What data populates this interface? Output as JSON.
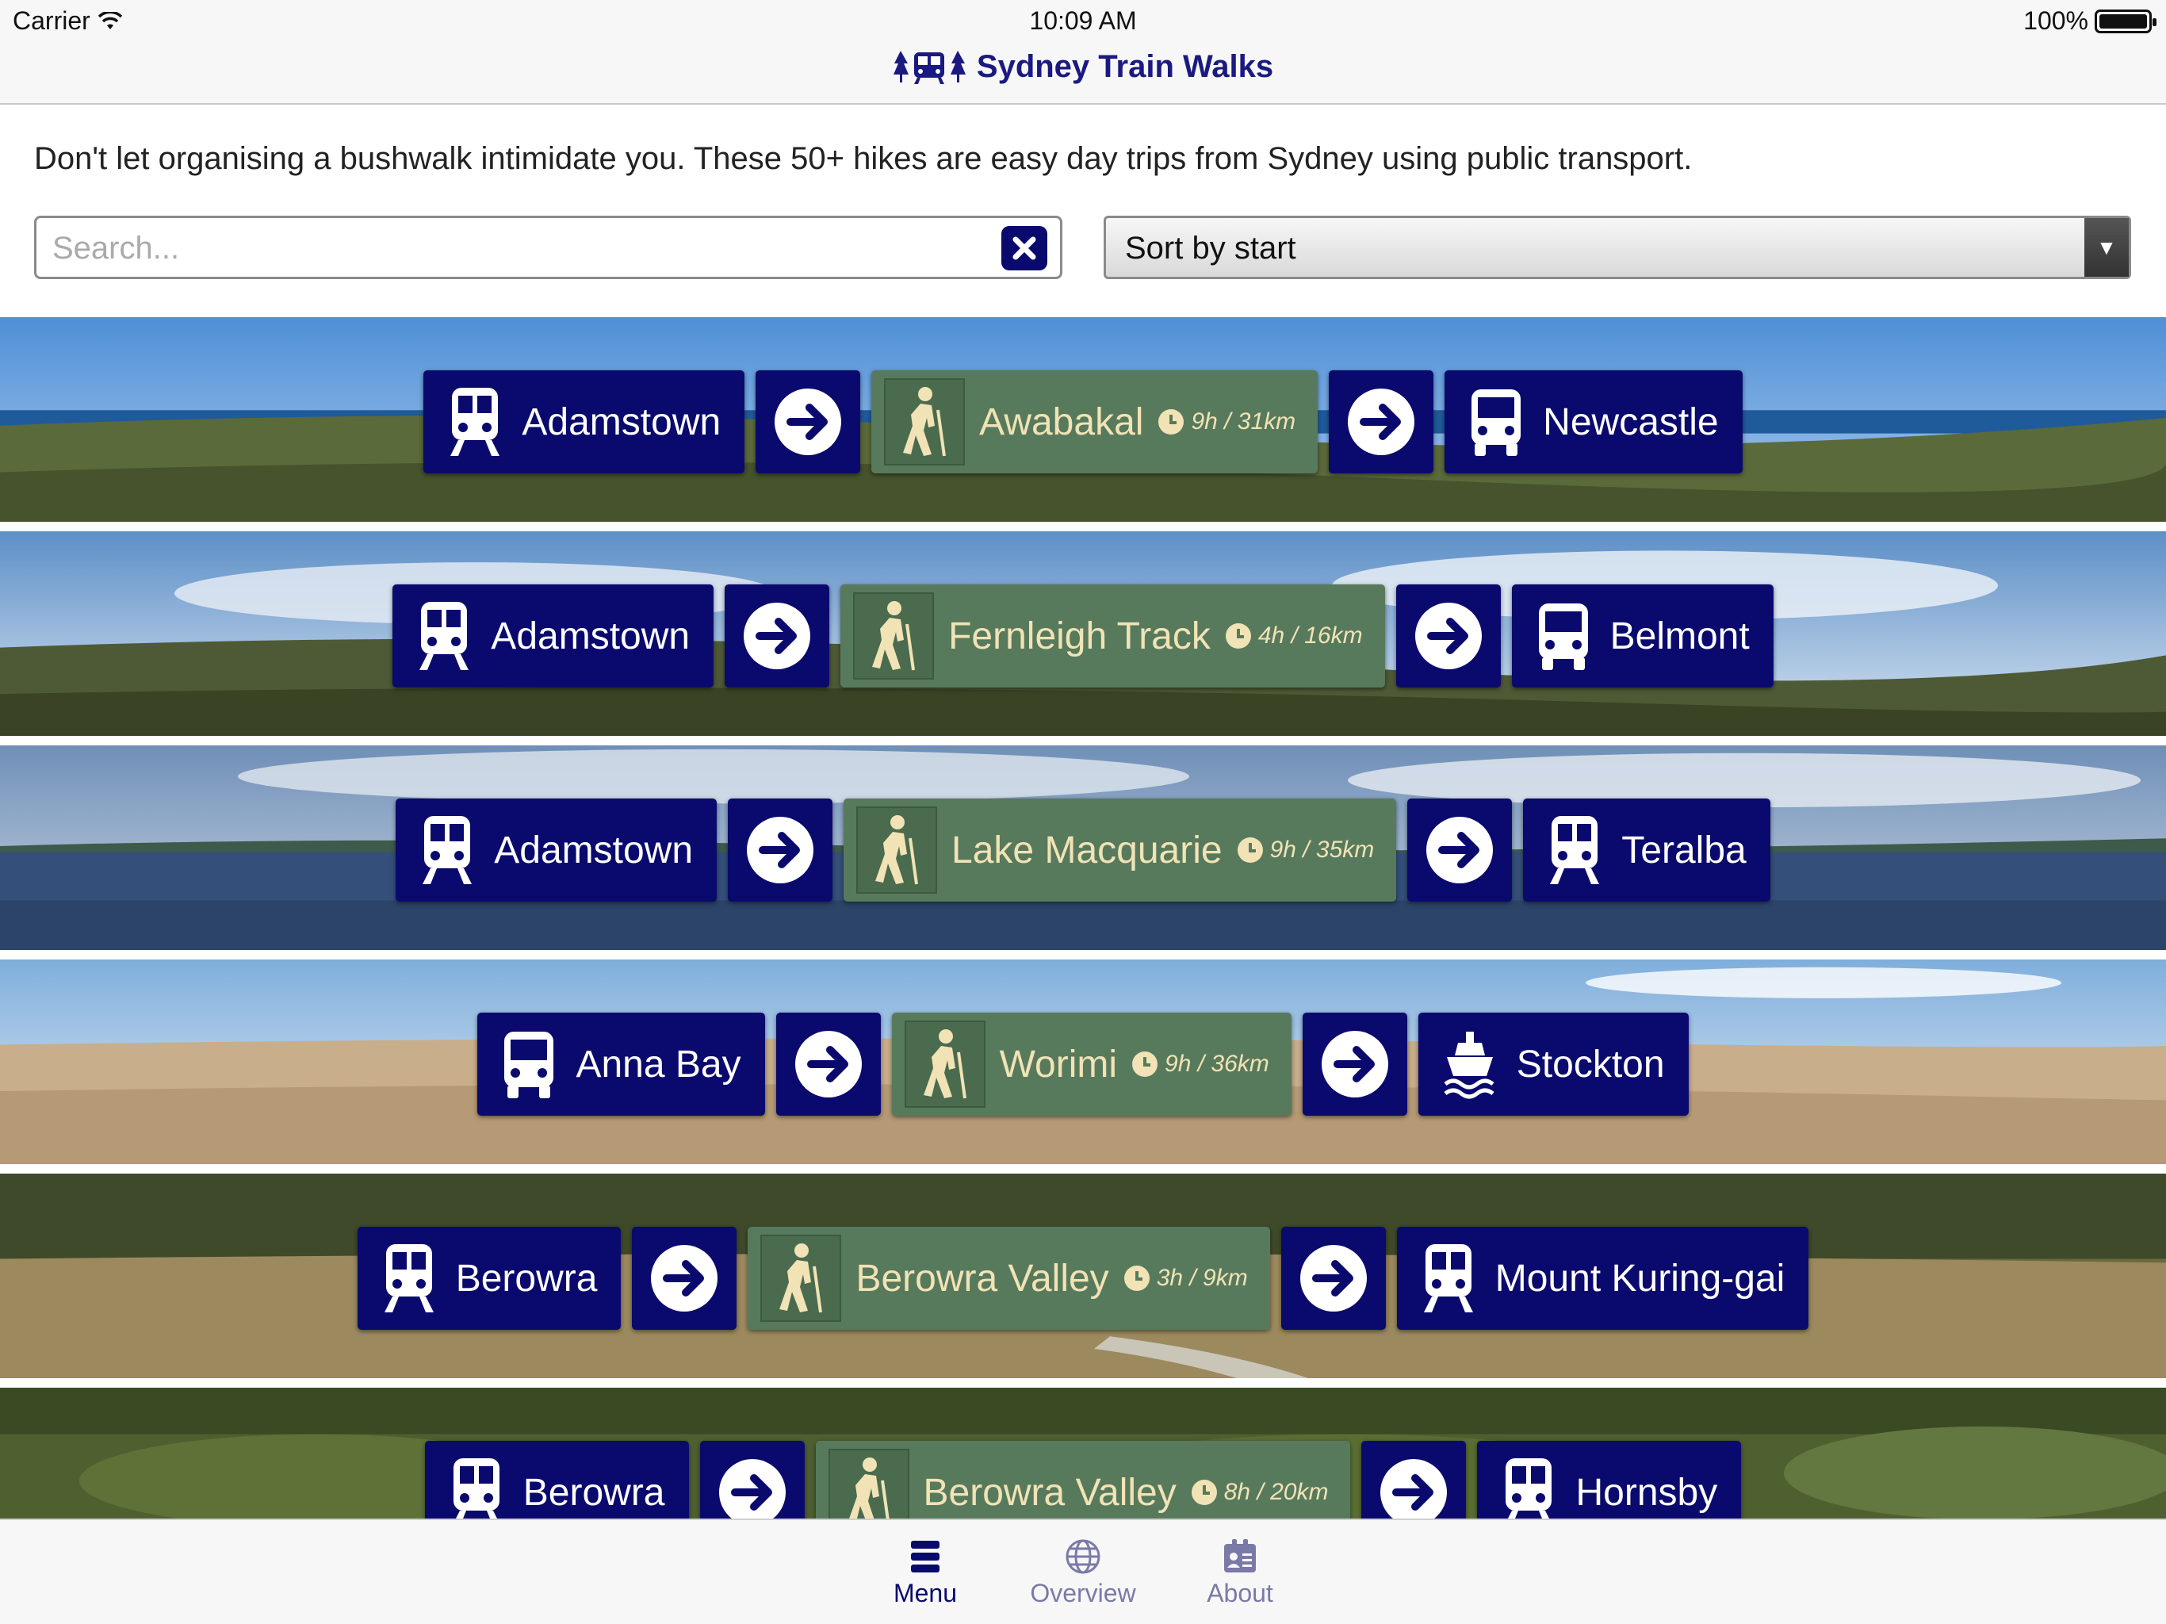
{
  "status": {
    "carrier": "Carrier",
    "time": "10:09 AM",
    "battery": "100%"
  },
  "nav": {
    "title": "Sydney Train Walks"
  },
  "intro": "Don't let organising a bushwalk intimidate you. These 50+ hikes are easy day trips from Sydney using public transport.",
  "search": {
    "placeholder": "Search...",
    "value": ""
  },
  "sort": {
    "selected": "Sort by start"
  },
  "walks": [
    {
      "start": "Adamstown",
      "start_icon": "train-icon",
      "name": "Awabakal",
      "duration": "9h / 31km",
      "end": "Newcastle",
      "end_icon": "bus-icon"
    },
    {
      "start": "Adamstown",
      "start_icon": "train-icon",
      "name": "Fernleigh Track",
      "duration": "4h / 16km",
      "end": "Belmont",
      "end_icon": "bus-icon"
    },
    {
      "start": "Adamstown",
      "start_icon": "train-icon",
      "name": "Lake Macquarie",
      "duration": "9h / 35km",
      "end": "Teralba",
      "end_icon": "train-icon"
    },
    {
      "start": "Anna Bay",
      "start_icon": "bus-icon",
      "name": "Worimi",
      "duration": "9h / 36km",
      "end": "Stockton",
      "end_icon": "ferry-icon"
    },
    {
      "start": "Berowra",
      "start_icon": "train-icon",
      "name": "Berowra Valley",
      "duration": "3h / 9km",
      "end": "Mount Kuring-gai",
      "end_icon": "train-icon"
    },
    {
      "start": "Berowra",
      "start_icon": "train-icon",
      "name": "Berowra Valley",
      "duration": "8h / 20km",
      "end": "Hornsby",
      "end_icon": "train-icon"
    }
  ],
  "tabs": [
    {
      "label": "Menu",
      "icon": "menu-icon",
      "active": true
    },
    {
      "label": "Overview",
      "icon": "globe-icon",
      "active": false
    },
    {
      "label": "About",
      "icon": "id-card-icon",
      "active": false
    }
  ],
  "colors": {
    "accent": "#0a0a6e",
    "walk_chip": "#587a5c",
    "walk_text": "#f1e3b6"
  }
}
